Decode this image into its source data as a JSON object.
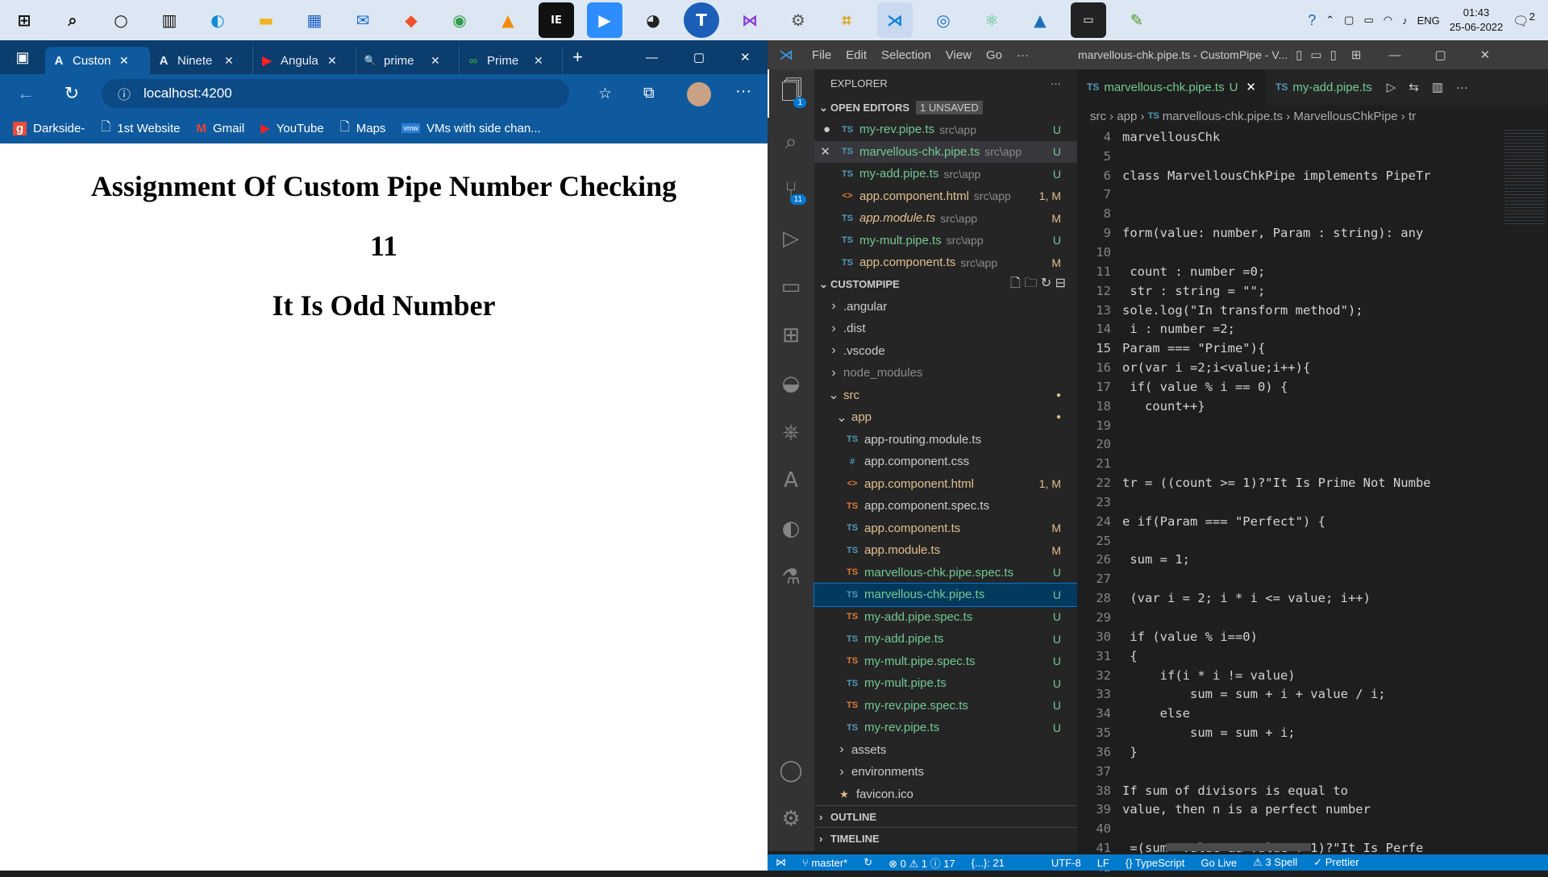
{
  "taskbar": {
    "apps": [
      "windows-start",
      "search",
      "cortana",
      "task-view",
      "edge",
      "file-explorer",
      "store",
      "mail",
      "brave",
      "chrome",
      "vlc",
      "jetbrains",
      "zoom",
      "obs",
      "t-app",
      "visual-studio",
      "app-1",
      "app-2",
      "vscode",
      "app-3",
      "atom",
      "photos",
      "terminal",
      "app-4"
    ],
    "language": "ENG",
    "time": "01:43",
    "date": "25-06-2022",
    "notifications": "2"
  },
  "browser": {
    "tabs": [
      {
        "label": "Custon",
        "favicon": "A"
      },
      {
        "label": "Ninete",
        "favicon": "A"
      },
      {
        "label": "Angula",
        "favicon": "▶"
      },
      {
        "label": "prime",
        "favicon": "🔍"
      },
      {
        "label": "Prime",
        "favicon": "∞"
      }
    ],
    "url": "localhost:4200",
    "bookmarks": [
      "Darkside-",
      "1st Website",
      "Gmail",
      "YouTube",
      "Maps",
      "VMs with side chan..."
    ]
  },
  "page": {
    "heading": "Assignment Of Custom Pipe Number Checking",
    "number": "11",
    "result": "It Is Odd Number"
  },
  "vscode": {
    "menu": [
      "File",
      "Edit",
      "Selection",
      "View",
      "Go",
      "···"
    ],
    "title": "marvellous-chk.pipe.ts - CustomPipe - V...",
    "explorer_title": "EXPLORER",
    "open_editors_label": "OPEN EDITORS",
    "unsaved_badge": "1 UNSAVED",
    "open_editors": [
      {
        "name": "my-rev.pipe.ts",
        "path": "src\\app",
        "tag": "U",
        "marker": "●"
      },
      {
        "name": "marvellous-chk.pipe.ts",
        "path": "src\\app",
        "tag": "U",
        "marker": "✕"
      },
      {
        "name": "my-add.pipe.ts",
        "path": "src\\app",
        "tag": "U",
        "marker": ""
      },
      {
        "name": "app.component.html",
        "path": "src\\app",
        "tag": "1, M",
        "marker": ""
      },
      {
        "name": "app.module.ts",
        "path": "src\\app",
        "tag": "M",
        "marker": ""
      },
      {
        "name": "my-mult.pipe.ts",
        "path": "src\\app",
        "tag": "U",
        "marker": ""
      },
      {
        "name": "app.component.ts",
        "path": "src\\app",
        "tag": "M",
        "marker": ""
      }
    ],
    "project_label": "CUSTOMPIPE",
    "tree": [
      {
        "name": ".angular",
        "indent": 1,
        "type": "folder"
      },
      {
        "name": ".dist",
        "indent": 1,
        "type": "folder"
      },
      {
        "name": ".vscode",
        "indent": 1,
        "type": "folder"
      },
      {
        "name": "node_modules",
        "indent": 1,
        "type": "folder"
      },
      {
        "name": "src",
        "indent": 1,
        "type": "folder-open"
      },
      {
        "name": "app",
        "indent": 2,
        "type": "folder-open"
      },
      {
        "name": "app-routing.module.ts",
        "indent": 3,
        "type": "ts",
        "tag": ""
      },
      {
        "name": "app.component.css",
        "indent": 3,
        "type": "css",
        "tag": ""
      },
      {
        "name": "app.component.html",
        "indent": 3,
        "type": "html",
        "tag": "1, M"
      },
      {
        "name": "app.component.spec.ts",
        "indent": 3,
        "type": "spec",
        "tag": ""
      },
      {
        "name": "app.component.ts",
        "indent": 3,
        "type": "ts",
        "tag": "M"
      },
      {
        "name": "app.module.ts",
        "indent": 3,
        "type": "ts",
        "tag": "M"
      },
      {
        "name": "marvellous-chk.pipe.spec.ts",
        "indent": 3,
        "type": "spec",
        "tag": "U"
      },
      {
        "name": "marvellous-chk.pipe.ts",
        "indent": 3,
        "type": "ts",
        "tag": "U"
      },
      {
        "name": "my-add.pipe.spec.ts",
        "indent": 3,
        "type": "spec",
        "tag": "U"
      },
      {
        "name": "my-add.pipe.ts",
        "indent": 3,
        "type": "ts",
        "tag": "U"
      },
      {
        "name": "my-mult.pipe.spec.ts",
        "indent": 3,
        "type": "spec",
        "tag": "U"
      },
      {
        "name": "my-mult.pipe.ts",
        "indent": 3,
        "type": "ts",
        "tag": "U"
      },
      {
        "name": "my-rev.pipe.spec.ts",
        "indent": 3,
        "type": "spec",
        "tag": "U"
      },
      {
        "name": "my-rev.pipe.ts",
        "indent": 3,
        "type": "ts",
        "tag": "U"
      },
      {
        "name": "assets",
        "indent": 2,
        "type": "folder"
      },
      {
        "name": "environments",
        "indent": 2,
        "type": "folder"
      },
      {
        "name": "favicon.ico",
        "indent": 2,
        "type": "star"
      }
    ],
    "outline_label": "OUTLINE",
    "timeline_label": "TIMELINE",
    "editor_tabs": [
      {
        "label": "marvellous-chk.pipe.ts",
        "tag": "U"
      },
      {
        "label": "my-add.pipe.ts",
        "tag": ""
      }
    ],
    "breadcrumb": [
      "src",
      "app",
      "marvellous-chk.pipe.ts",
      "MarvellousChkPipe",
      "tr"
    ],
    "code": [
      {
        "n": "4",
        "t": "marvellousChk"
      },
      {
        "n": "5",
        "t": ""
      },
      {
        "n": "6",
        "t": "class MarvellousChkPipe implements PipeTr"
      },
      {
        "n": "7",
        "t": ""
      },
      {
        "n": "8",
        "t": ""
      },
      {
        "n": "9",
        "t": "form(value: number, Param : string): any"
      },
      {
        "n": "10",
        "t": ""
      },
      {
        "n": "11",
        "t": " count : number =0;"
      },
      {
        "n": "12",
        "t": " str : string = \"\";"
      },
      {
        "n": "13",
        "t": "sole.log(\"In transform method\");"
      },
      {
        "n": "14",
        "t": " i : number =2;"
      },
      {
        "n": "15",
        "t": "Param === \"Prime\"){"
      },
      {
        "n": "16",
        "t": "or(var i =2;i<value;i++){"
      },
      {
        "n": "17",
        "t": " if( value % i == 0) {"
      },
      {
        "n": "18",
        "t": "   count++}"
      },
      {
        "n": "19",
        "t": ""
      },
      {
        "n": "20",
        "t": ""
      },
      {
        "n": "21",
        "t": ""
      },
      {
        "n": "22",
        "t": "tr = ((count >= 1)?\"It Is Prime Not Numbe"
      },
      {
        "n": "23",
        "t": ""
      },
      {
        "n": "24",
        "t": "e if(Param === \"Perfect\") {"
      },
      {
        "n": "25",
        "t": ""
      },
      {
        "n": "26",
        "t": " sum = 1;"
      },
      {
        "n": "27",
        "t": ""
      },
      {
        "n": "28",
        "t": " (var i = 2; i * i <= value; i++)"
      },
      {
        "n": "29",
        "t": ""
      },
      {
        "n": "30",
        "t": " if (value % i==0)"
      },
      {
        "n": "31",
        "t": " {"
      },
      {
        "n": "32",
        "t": "     if(i * i != value)"
      },
      {
        "n": "33",
        "t": "         sum = sum + i + value / i;"
      },
      {
        "n": "34",
        "t": "     else"
      },
      {
        "n": "35",
        "t": "         sum = sum + i;"
      },
      {
        "n": "36",
        "t": " }"
      },
      {
        "n": "37",
        "t": ""
      },
      {
        "n": "38",
        "t": "If sum of divisors is equal to"
      },
      {
        "n": "39",
        "t": "value, then n is a perfect number"
      },
      {
        "n": "40",
        "t": ""
      },
      {
        "n": "41",
        "t": " =(sum==value && value !=1)?\"It Is Perfe"
      },
      {
        "n": "42",
        "t": ""
      }
    ],
    "current_line": "15",
    "status": {
      "branch": "master*",
      "problems": "⊗ 0 ⚠ 1 ⓘ 17",
      "braces": "{...}: 21",
      "encoding": "UTF-8",
      "eol": "LF",
      "language": "{} TypeScript",
      "golive": "Go Live",
      "spell": "⚠ 3 Spell",
      "prettier": "✓ Prettier"
    }
  }
}
